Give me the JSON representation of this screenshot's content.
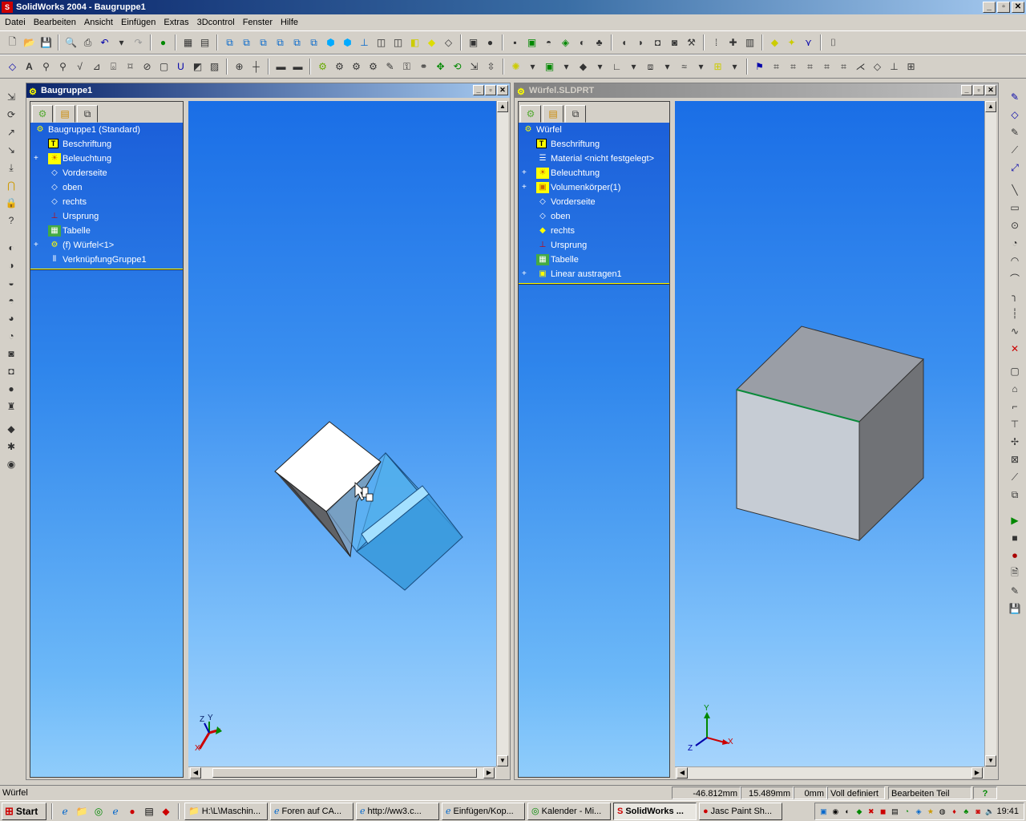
{
  "app": {
    "title": "SolidWorks 2004 - Baugruppe1",
    "icon": "solidworks-icon"
  },
  "menu": [
    "Datei",
    "Bearbeiten",
    "Ansicht",
    "Einfügen",
    "Extras",
    "3Dcontrol",
    "Fenster",
    "Hilfe"
  ],
  "windows": {
    "left": {
      "title": "Baugruppe1",
      "tree": [
        {
          "label": "Baugruppe1  (Standard)",
          "icon": "assembly-icon",
          "level": 0,
          "expand": false
        },
        {
          "label": "Beschriftung",
          "icon": "annotation-icon",
          "level": 1,
          "expand": false
        },
        {
          "label": "Beleuchtung",
          "icon": "lighting-icon",
          "level": 1,
          "expand": true
        },
        {
          "label": "Vorderseite",
          "icon": "plane-icon",
          "level": 1,
          "expand": false
        },
        {
          "label": "oben",
          "icon": "plane-icon",
          "level": 1,
          "expand": false
        },
        {
          "label": "rechts",
          "icon": "plane-icon",
          "level": 1,
          "expand": false
        },
        {
          "label": "Ursprung",
          "icon": "origin-icon",
          "level": 1,
          "expand": false
        },
        {
          "label": "Tabelle",
          "icon": "table-icon",
          "level": 1,
          "expand": false
        },
        {
          "label": "(f) Würfel<1>",
          "icon": "part-icon",
          "level": 1,
          "expand": true
        },
        {
          "label": "VerknüpfungGruppe1",
          "icon": "mates-icon",
          "level": 1,
          "expand": false
        }
      ]
    },
    "right": {
      "title": "Würfel.SLDPRT",
      "tree": [
        {
          "label": "Würfel",
          "icon": "part-icon",
          "level": 0,
          "expand": false
        },
        {
          "label": "Beschriftung",
          "icon": "annotation-icon",
          "level": 1,
          "expand": false
        },
        {
          "label": "Material <nicht festgelegt>",
          "icon": "material-icon",
          "level": 1,
          "expand": false
        },
        {
          "label": "Beleuchtung",
          "icon": "lighting-icon",
          "level": 1,
          "expand": true
        },
        {
          "label": "Volumenkörper(1)",
          "icon": "solid-bodies-icon",
          "level": 1,
          "expand": true
        },
        {
          "label": "Vorderseite",
          "icon": "plane-icon",
          "level": 1,
          "expand": false
        },
        {
          "label": "oben",
          "icon": "plane-icon",
          "level": 1,
          "expand": false
        },
        {
          "label": "rechts",
          "icon": "plane-icon-selected",
          "level": 1,
          "expand": false
        },
        {
          "label": "Ursprung",
          "icon": "origin-icon",
          "level": 1,
          "expand": false
        },
        {
          "label": "Tabelle",
          "icon": "table-icon",
          "level": 1,
          "expand": false
        },
        {
          "label": "Linear austragen1",
          "icon": "extrude-icon",
          "level": 1,
          "expand": true
        }
      ]
    }
  },
  "triad": {
    "x": "X",
    "y": "Y",
    "z": "Z"
  },
  "status": {
    "left": "Würfel",
    "x": "-46.812mm",
    "y": "15.489mm",
    "z": "0mm",
    "state": "Voll definiert",
    "mode": "Bearbeiten Teil",
    "help": "?"
  },
  "taskbar": {
    "start": "Start",
    "tasks": [
      "H:\\L\\Maschin...",
      "Foren auf CA...",
      "http://ww3.c...",
      "Einfügen/Kop...",
      "Kalender - Mi...",
      "SolidWorks ...",
      "Jasc Paint Sh..."
    ],
    "active_index": 5,
    "clock": "19:41"
  }
}
